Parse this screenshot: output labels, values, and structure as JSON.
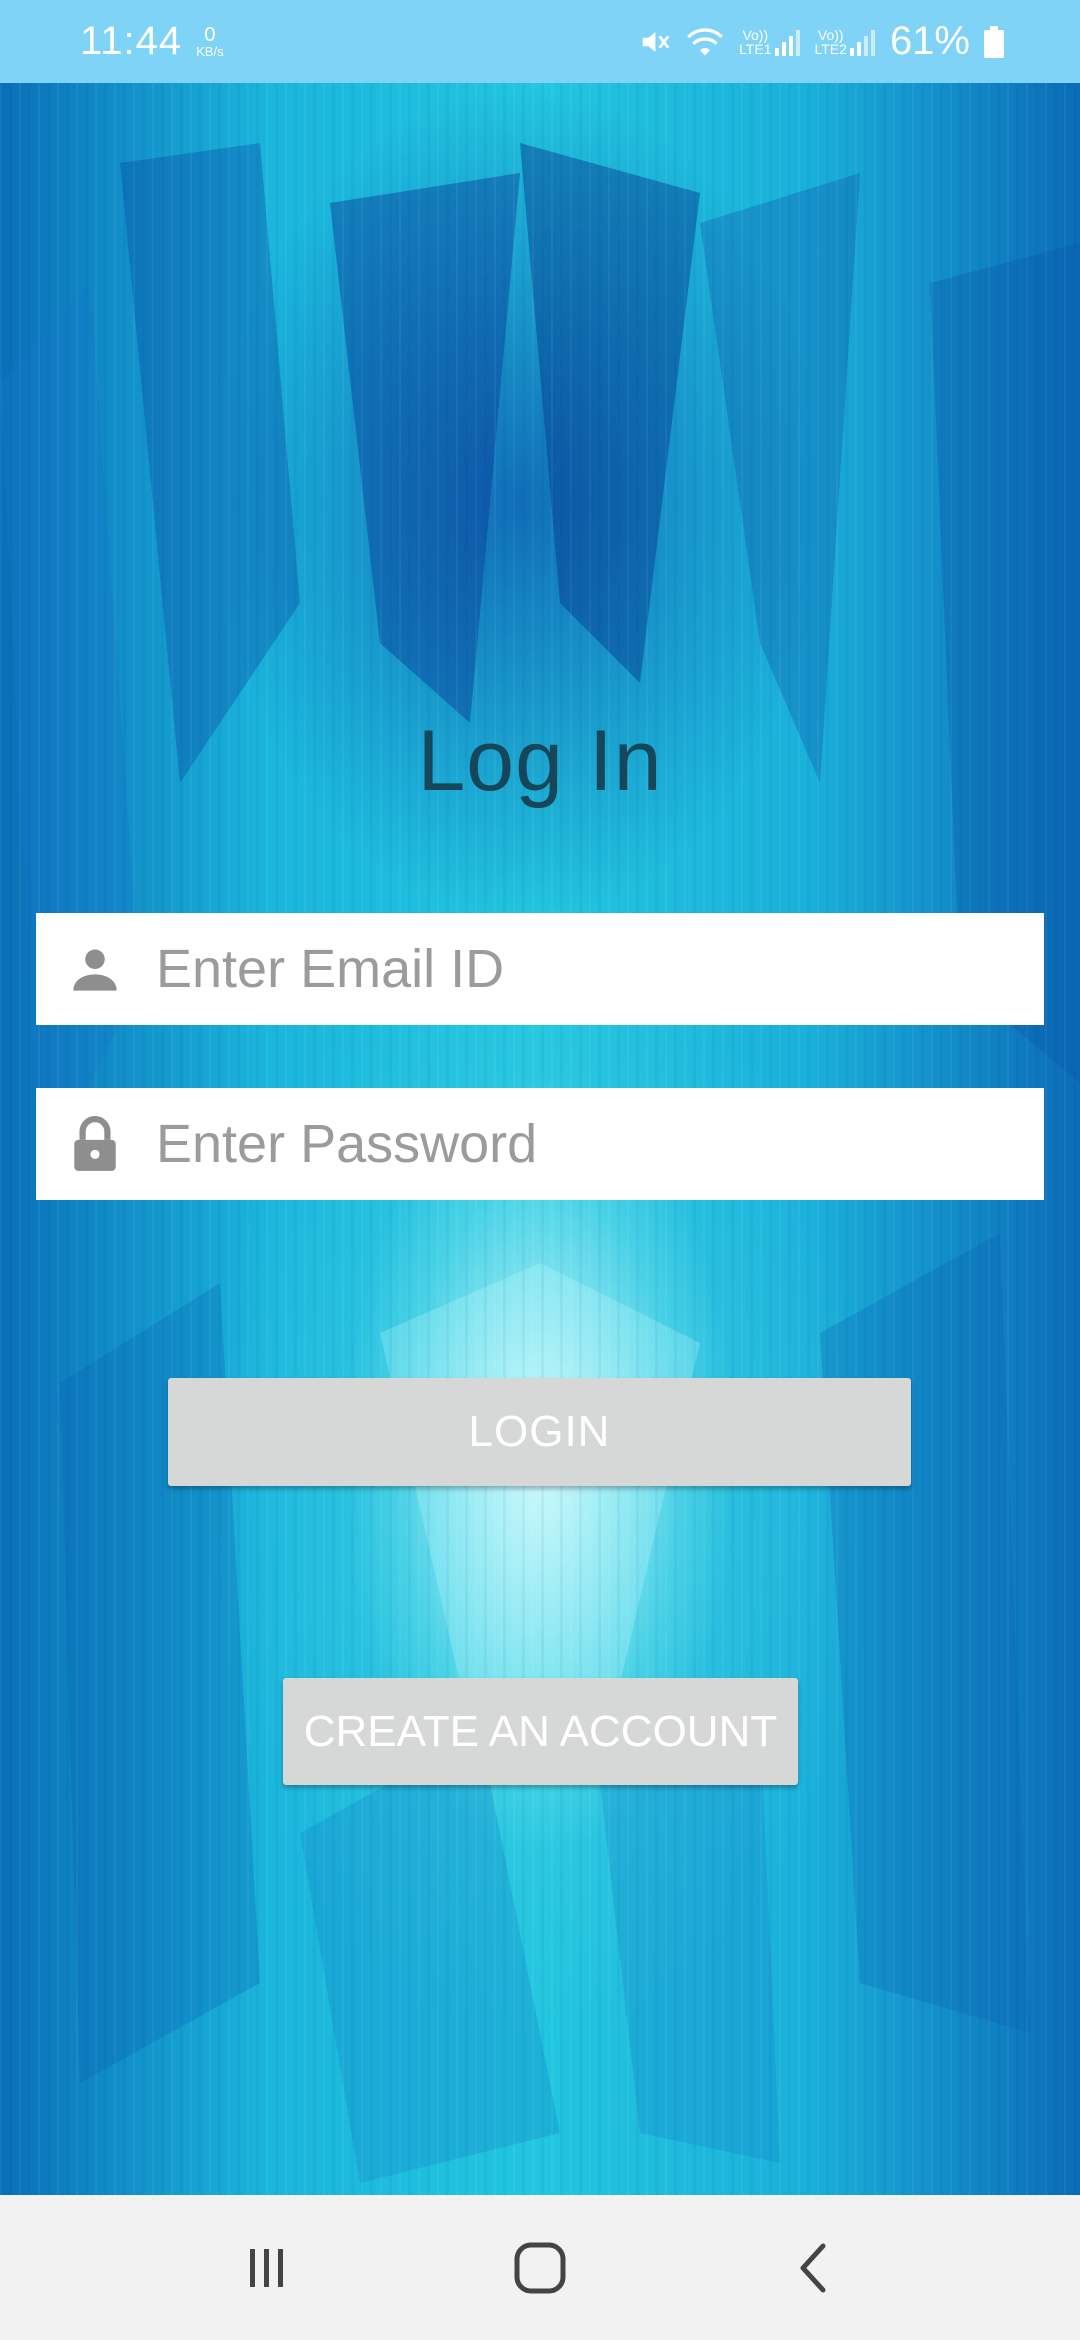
{
  "status_bar": {
    "time": "11:44",
    "net_speed_value": "0",
    "net_speed_unit": "KB/s",
    "sim1_label_top": "Vo))",
    "sim1_label_bottom": "LTE1",
    "sim2_label_top": "Vo))",
    "sim2_label_bottom": "LTE2",
    "battery_percent": "61%",
    "icons": [
      "mute-icon",
      "wifi-icon",
      "signal-icon",
      "battery-icon"
    ]
  },
  "login": {
    "title": "Log In",
    "email_placeholder": "Enter Email ID",
    "password_placeholder": "Enter Password",
    "login_label": "LOGIN",
    "create_account_label": "CREATE AN ACCOUNT",
    "icons": [
      "person-icon",
      "lock-icon"
    ]
  },
  "nav_bar": {
    "icons": [
      "recents-icon",
      "home-icon",
      "back-icon"
    ]
  },
  "colors": {
    "status_bar_bg": "#7fd3f7",
    "title_text": "#15465a",
    "button_bg": "#d6d7d7",
    "nav_bar_bg": "#f2f2f2"
  }
}
